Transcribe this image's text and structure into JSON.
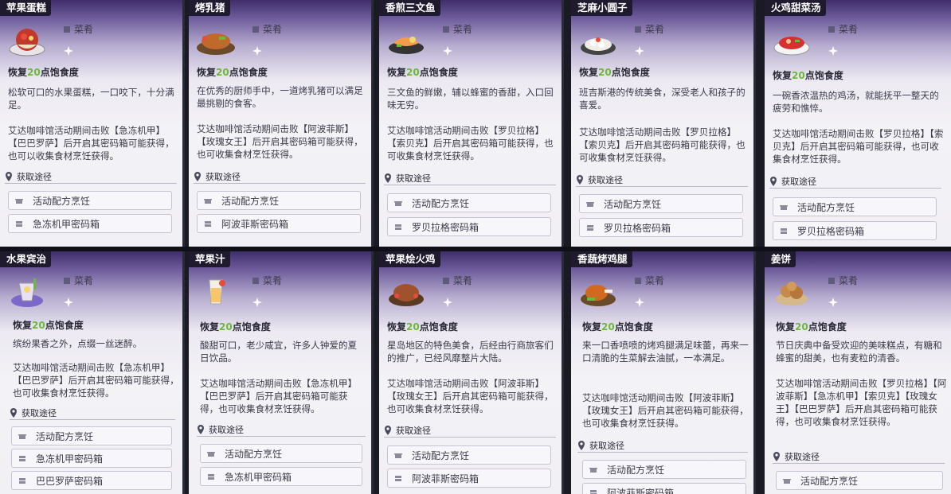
{
  "common": {
    "type_label": "菜肴",
    "restore_prefix": "恢复",
    "restore_suffix": "点饱食度",
    "route_label": "获取途径"
  },
  "cards": [
    {
      "title": "苹果蛋糕",
      "amount": "20",
      "desc": "松软可口的水果蛋糕，一口咬下，十分满足。",
      "source": "艾达咖啡馆活动期间击败【急冻机甲】【巴巴罗萨】后开启其密码箱可能获得，也可以收集食材烹饪获得。",
      "routes": [
        "活动配方烹饪",
        "急冻机甲密码箱"
      ]
    },
    {
      "title": "烤乳猪",
      "amount": "20",
      "desc": "在优秀的厨师手中，一道烤乳猪可以满足最挑剔的食客。",
      "source": "艾达咖啡馆活动期间击败【阿波菲斯】【玫瑰女王】后开启其密码箱可能获得，也可收集食材烹饪获得。",
      "routes": [
        "活动配方烹饪",
        "阿波菲斯密码箱"
      ]
    },
    {
      "title": "香煎三文鱼",
      "amount": "20",
      "desc": "三文鱼的鲜嫩，辅以蜂蜜的香甜，入口回味无穷。",
      "source": "艾达咖啡馆活动期间击败【罗贝拉格】【索贝克】后开启其密码箱可能获得，也可收集食材烹饪获得。",
      "routes": [
        "活动配方烹饪",
        "罗贝拉格密码箱"
      ]
    },
    {
      "title": "芝麻小圆子",
      "amount": "20",
      "desc": "班吉斯港的传统美食，深受老人和孩子的喜爱。",
      "source": "艾达咖啡馆活动期间击败【罗贝拉格】【索贝克】后开启其密码箱可能获得，也可收集食材烹饪获得。",
      "routes": [
        "活动配方烹饪",
        "罗贝拉格密码箱"
      ]
    },
    {
      "title": "火鸡甜菜汤",
      "amount": "20",
      "desc": "一碗香浓温热的鸡汤，就能抚平一整天的疲劳和憔悴。",
      "source": "艾达咖啡馆活动期间击败【罗贝拉格】【索贝克】后开启其密码箱可能获得，也可收集食材烹饪获得。",
      "routes": [
        "活动配方烹饪",
        "罗贝拉格密码箱"
      ]
    },
    {
      "title": "水果宾治",
      "amount": "20",
      "desc": "缤纷果香之外，点缀一丝迷醉。",
      "source": "艾达咖啡馆活动期间击败【急冻机甲】【巴巴罗萨】后开启其密码箱可能获得，也可收集食材烹饪获得。",
      "routes": [
        "活动配方烹饪",
        "急冻机甲密码箱",
        "巴巴罗萨密码箱"
      ]
    },
    {
      "title": "苹果汁",
      "amount": "20",
      "desc": "酸甜可口，老少咸宜，许多人钟爱的夏日饮品。",
      "source": "艾达咖啡馆活动期间击败【急冻机甲】【巴巴罗萨】后开启其密码箱可能获得，也可收集食材烹饪获得。",
      "routes": [
        "活动配方烹饪",
        "急冻机甲密码箱"
      ]
    },
    {
      "title": "苹果烩火鸡",
      "amount": "20",
      "desc": "星岛地区的特色美食，后经由行商旅客们的推广，已经风靡整片大陆。",
      "source": "艾达咖啡馆活动期间击败【阿波菲斯】【玫瑰女王】后开启其密码箱可能获得，也可收集食材烹饪获得。",
      "routes": [
        "活动配方烹饪",
        "阿波菲斯密码箱"
      ]
    },
    {
      "title": "香蔬烤鸡腿",
      "amount": "20",
      "desc": "来一口香喷喷的烤鸡腿满足味蕾，再来一口清脆的生菜解去油腻，一本满足。",
      "source": "艾达咖啡馆活动期间击败【阿波菲斯】【玫瑰女王】后开启其密码箱可能获得，也可收集食材烹饪获得。",
      "routes": [
        "活动配方烹饪",
        "阿波菲斯密码箱"
      ]
    },
    {
      "title": "姜饼",
      "amount": "20",
      "desc": "节日庆典中备受欢迎的美味糕点，有糖和蜂蜜的甜美，也有麦粒的清香。",
      "source": "艾达咖啡馆活动期间击败【罗贝拉格】【阿波菲斯】【急冻机甲】【索贝克】【玫瑰女王】【巴巴罗萨】后开启其密码箱可能获得，也可收集食材烹饪获得。",
      "routes": [
        "活动配方烹饪"
      ]
    }
  ]
}
